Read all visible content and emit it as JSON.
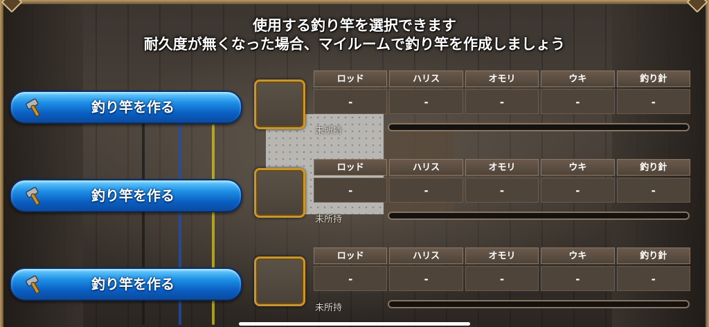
{
  "header": {
    "line1": "使用する釣り竿を選択できます",
    "line2": "耐久度が無くなった場合、マイルームで釣り竿を作成しましょう"
  },
  "accent_colors": {
    "button_blue": "#1e8fe6",
    "slot_gold": "#c8962e"
  },
  "rods": [
    {
      "button_label": "釣り竿を作る",
      "button_icon": "hammer-icon",
      "columns": [
        "ロッド",
        "ハリス",
        "オモリ",
        "ウキ",
        "釣り針"
      ],
      "values": [
        "-",
        "-",
        "-",
        "-",
        "-"
      ],
      "status": "未所持",
      "durability": 0
    },
    {
      "button_label": "釣り竿を作る",
      "button_icon": "hammer-icon",
      "columns": [
        "ロッド",
        "ハリス",
        "オモリ",
        "ウキ",
        "釣り針"
      ],
      "values": [
        "-",
        "-",
        "-",
        "-",
        "-"
      ],
      "status": "未所持",
      "durability": 0
    },
    {
      "button_label": "釣り竿を作る",
      "button_icon": "hammer-icon",
      "columns": [
        "ロッド",
        "ハリス",
        "オモリ",
        "ウキ",
        "釣り針"
      ],
      "values": [
        "-",
        "-",
        "-",
        "-",
        "-"
      ],
      "status": "未所持",
      "durability": 0
    }
  ]
}
